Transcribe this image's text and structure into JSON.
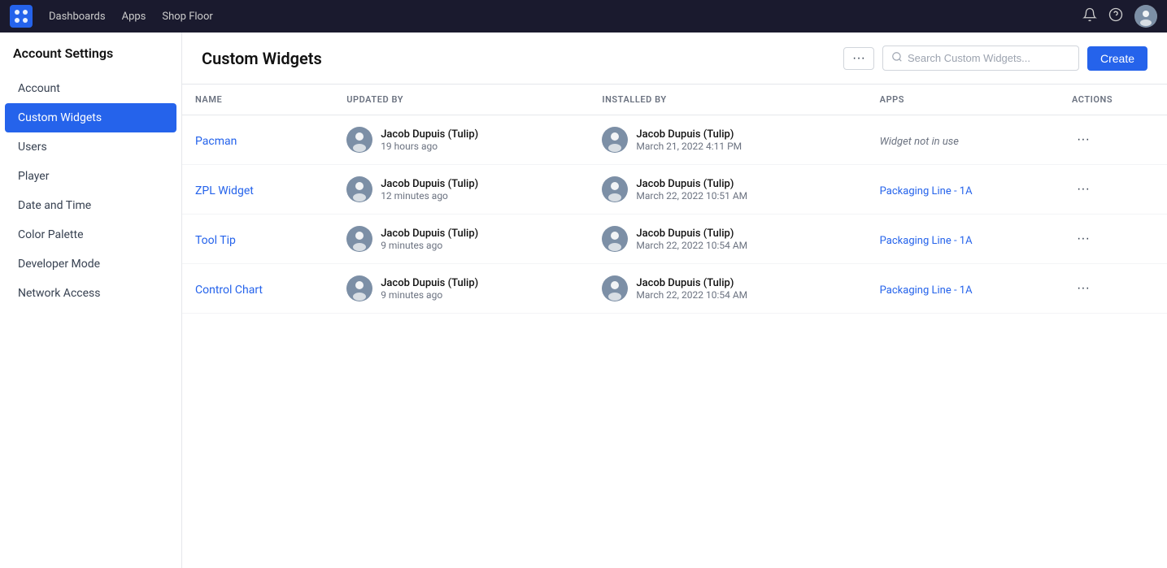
{
  "topnav": {
    "links": [
      "Dashboards",
      "Apps",
      "Shop Floor"
    ],
    "icons": [
      "notification-icon",
      "help-icon",
      "user-avatar"
    ]
  },
  "sidebar": {
    "title": "Account Settings",
    "items": [
      {
        "id": "account",
        "label": "Account",
        "active": false
      },
      {
        "id": "custom-widgets",
        "label": "Custom Widgets",
        "active": true
      },
      {
        "id": "users",
        "label": "Users",
        "active": false
      },
      {
        "id": "player",
        "label": "Player",
        "active": false
      },
      {
        "id": "date-time",
        "label": "Date and Time",
        "active": false
      },
      {
        "id": "color-palette",
        "label": "Color Palette",
        "active": false
      },
      {
        "id": "developer-mode",
        "label": "Developer Mode",
        "active": false
      },
      {
        "id": "network-access",
        "label": "Network Access",
        "active": false
      }
    ]
  },
  "page": {
    "title": "Custom Widgets",
    "search_placeholder": "Search Custom Widgets...",
    "create_label": "Create",
    "more_icon": "···"
  },
  "table": {
    "columns": [
      "NAME",
      "UPDATED BY",
      "INSTALLED BY",
      "APPS",
      "ACTIONS"
    ],
    "rows": [
      {
        "name": "Pacman",
        "updated_by_name": "Jacob Dupuis (Tulip)",
        "updated_by_time": "19 hours ago",
        "installed_by_name": "Jacob Dupuis (Tulip)",
        "installed_by_date": "March 21, 2022 4:11 PM",
        "apps": null,
        "apps_label": "Widget not in use",
        "actions": "···"
      },
      {
        "name": "ZPL Widget",
        "updated_by_name": "Jacob Dupuis (Tulip)",
        "updated_by_time": "12 minutes ago",
        "installed_by_name": "Jacob Dupuis (Tulip)",
        "installed_by_date": "March 22, 2022 10:51 AM",
        "apps": "Packaging Line - 1A",
        "apps_label": null,
        "actions": "···"
      },
      {
        "name": "Tool Tip",
        "updated_by_name": "Jacob Dupuis (Tulip)",
        "updated_by_time": "9 minutes ago",
        "installed_by_name": "Jacob Dupuis (Tulip)",
        "installed_by_date": "March 22, 2022 10:54 AM",
        "apps": "Packaging Line - 1A",
        "apps_label": null,
        "actions": "···"
      },
      {
        "name": "Control Chart",
        "updated_by_name": "Jacob Dupuis (Tulip)",
        "updated_by_time": "9 minutes ago",
        "installed_by_name": "Jacob Dupuis (Tulip)",
        "installed_by_date": "March 22, 2022 10:54 AM",
        "apps": "Packaging Line - 1A",
        "apps_label": null,
        "actions": "···"
      }
    ]
  }
}
